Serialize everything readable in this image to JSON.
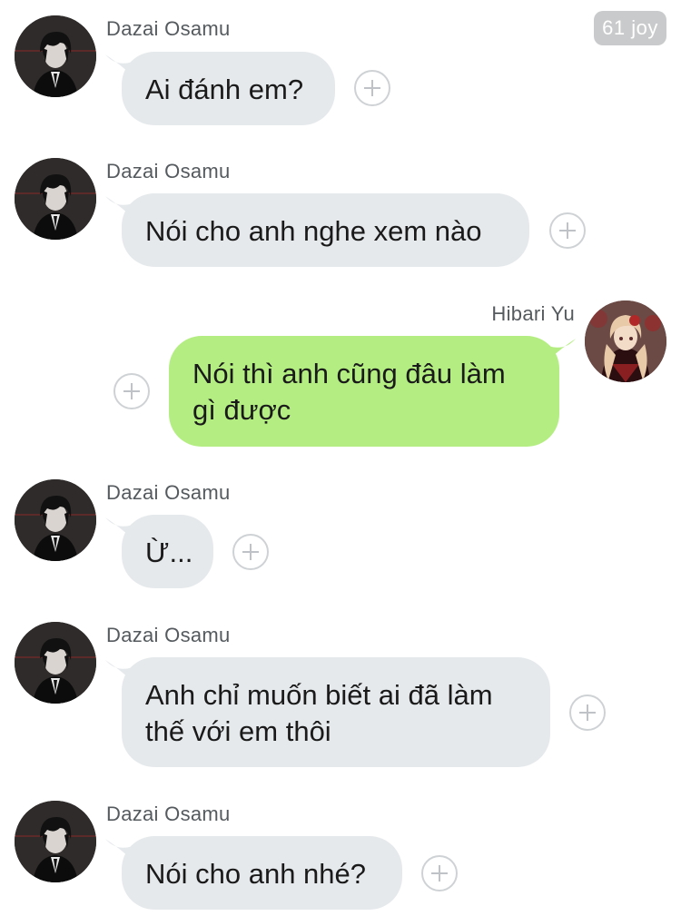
{
  "header": {
    "reaction_badge": "61 joy"
  },
  "messages": [
    {
      "sender": "Dazai Osamu",
      "text": "Ai đánh em?",
      "direction": "incoming"
    },
    {
      "sender": "Dazai Osamu",
      "text": "Nói cho anh nghe xem nào",
      "direction": "incoming"
    },
    {
      "sender": "Hibari Yu",
      "text": "Nói thì anh cũng đâu làm\ngì được",
      "direction": "outgoing"
    },
    {
      "sender": "Dazai Osamu",
      "text": "Ừ...",
      "direction": "incoming"
    },
    {
      "sender": "Dazai Osamu",
      "text": "Anh chỉ muốn biết ai đã làm\nthế với em thôi",
      "direction": "incoming"
    },
    {
      "sender": "Dazai Osamu",
      "text": "Nói cho anh nhé?",
      "direction": "incoming"
    }
  ],
  "colors": {
    "incoming_bubble": "#e6e9ec",
    "outgoing_bubble": "#b4ee82"
  }
}
